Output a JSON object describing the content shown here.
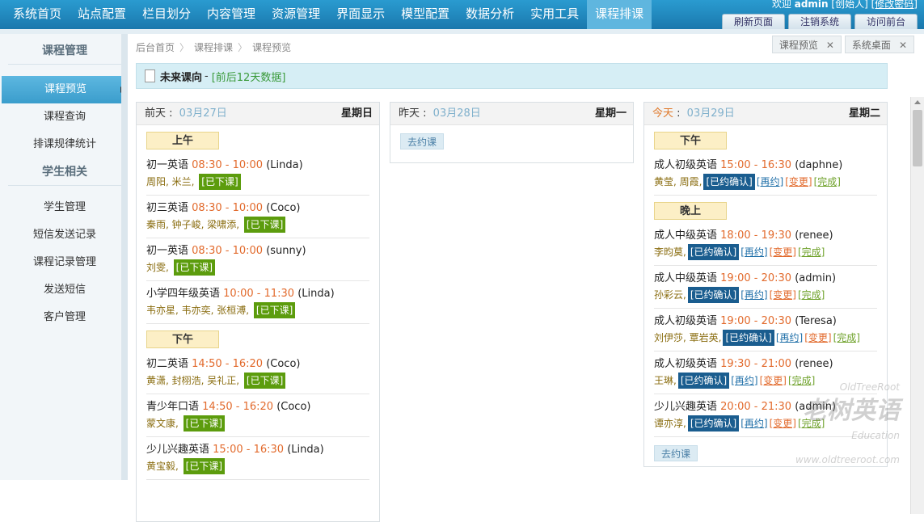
{
  "nav": [
    "系统首页",
    "站点配置",
    "栏目划分",
    "内容管理",
    "资源管理",
    "界面显示",
    "模型配置",
    "数据分析",
    "实用工具",
    "课程排课"
  ],
  "welcome": {
    "prefix": "欢迎",
    "user": "admin",
    "role": "[创始人]",
    "change_pwd": "[修改密码]"
  },
  "top_buttons": [
    "刷新页面",
    "注销系统",
    "访问前台"
  ],
  "sidebar": {
    "group1": "课程管理",
    "items1": [
      "课程预览",
      "课程查询",
      "排课规律统计"
    ],
    "group2": "学生相关",
    "items2": [
      "学生管理",
      "短信发送记录",
      "课程记录管理",
      "发送短信",
      "客户管理"
    ]
  },
  "breadcrumb": [
    "后台首页",
    "课程排课",
    "课程预览"
  ],
  "right_tabs": [
    "课程预览",
    "系统桌面"
  ],
  "info": {
    "title": "未来课向",
    "range": "[前后12天数据]"
  },
  "days": [
    {
      "label": "前天",
      "date": "03月27日",
      "weekday": "星期日",
      "sections": [
        {
          "period": "上午",
          "entries": [
            {
              "course": "初一英语",
              "time": "08:30 - 10:00",
              "teacher": "(Linda)",
              "students": "周阳, 米兰,",
              "status": "[已下课]"
            },
            {
              "course": "初三英语",
              "time": "08:30 - 10:00",
              "teacher": "(Coco)",
              "students": "秦雨, 钟子峻, 梁啸添,",
              "status": "[已下课]"
            },
            {
              "course": "初一英语",
              "time": "08:30 - 10:00",
              "teacher": "(sunny)",
              "students": "刘雯,",
              "status": "[已下课]"
            },
            {
              "course": "小学四年级英语",
              "time": "10:00 - 11:30",
              "teacher": "(Linda)",
              "students": "韦亦星, 韦亦奕, 张桓溥,",
              "status": "[已下课]"
            }
          ]
        },
        {
          "period": "下午",
          "entries": [
            {
              "course": "初二英语",
              "time": "14:50 - 16:20",
              "teacher": "(Coco)",
              "students": "黄潇, 封栩浩, 吴礼正,",
              "status": "[已下课]"
            },
            {
              "course": "青少年口语",
              "time": "14:50 - 16:20",
              "teacher": "(Coco)",
              "students": "蒙文康,",
              "status": "[已下课]"
            },
            {
              "course": "少儿兴趣英语",
              "time": "15:00 - 16:30",
              "teacher": "(Linda)",
              "students": "黄宝毅,",
              "status": "[已下课]"
            }
          ]
        }
      ]
    },
    {
      "label": "昨天",
      "date": "03月28日",
      "weekday": "星期一",
      "book": "去约课"
    },
    {
      "label": "今天",
      "date": "03月29日",
      "weekday": "星期二",
      "book": "去约课",
      "sections": [
        {
          "period": "下午",
          "entries": [
            {
              "course": "成人初级英语",
              "time": "15:00 - 16:30",
              "teacher": "(daphne)",
              "students": "黄莹, 周霞,",
              "confirm": "[已约确认]",
              "rebook": "[再约]",
              "change": "[变更]",
              "finish": "[完成]"
            }
          ]
        },
        {
          "period": "晚上",
          "entries": [
            {
              "course": "成人中级英语",
              "time": "18:00 - 19:30",
              "teacher": "(renee)",
              "students": "李昀莫,",
              "confirm": "[已约确认]",
              "rebook": "[再约]",
              "change": "[变更]",
              "finish": "[完成]"
            },
            {
              "course": "成人中级英语",
              "time": "19:00 - 20:30",
              "teacher": "(admin)",
              "students": "孙彩云,",
              "confirm": "[已约确认]",
              "rebook": "[再约]",
              "change": "[变更]",
              "finish": "[完成]"
            },
            {
              "course": "成人初级英语",
              "time": "19:00 - 20:30",
              "teacher": "(Teresa)",
              "students": "刘伊莎, 覃岩英,",
              "confirm": "[已约确认]",
              "rebook": "[再约]",
              "change": "[变更]",
              "finish": "[完成]"
            },
            {
              "course": "成人初级英语",
              "time": "19:30 - 21:00",
              "teacher": "(renee)",
              "students": "王琳,",
              "confirm": "[已约确认]",
              "rebook": "[再约]",
              "change": "[变更]",
              "finish": "[完成]"
            },
            {
              "course": "少儿兴趣英语",
              "time": "20:00 - 21:30",
              "teacher": "(admin)",
              "students": "谭亦淳,",
              "confirm": "[已约确认]",
              "rebook": "[再约]",
              "change": "[变更]",
              "finish": "[完成]"
            }
          ]
        }
      ]
    }
  ],
  "watermark": {
    "brand": "老树英语",
    "en1": "OldTreeRoot",
    "en2": "Education",
    "url": "www.oldtreeroot.com"
  }
}
